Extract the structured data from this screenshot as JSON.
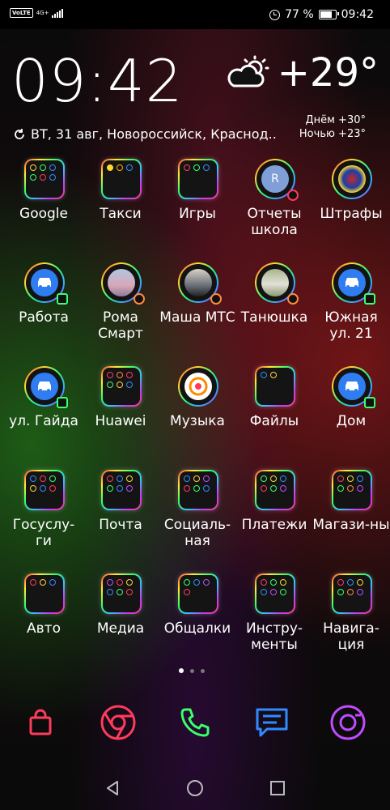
{
  "status": {
    "volte": "VoLTE",
    "network": "4G+",
    "battery": "77 %",
    "battery_level": 0.77,
    "time": "09:42"
  },
  "widget": {
    "time": "09:42",
    "temperature": "+29°",
    "weather_icon": "sun-cloud-icon",
    "day": "Днём +30°",
    "night": "Ночью +23°",
    "date_location": "ВТ, 31 авг, Новороссийск, Краснод.."
  },
  "apps": {
    "row1": [
      {
        "label": "Google",
        "kind": "folder"
      },
      {
        "label": "Такси",
        "kind": "folder"
      },
      {
        "label": "Игры",
        "kind": "folder"
      },
      {
        "label": "Отчеты школа",
        "kind": "contact",
        "avatar_letter": "R"
      },
      {
        "label": "Штрафы",
        "kind": "app"
      }
    ],
    "row2": [
      {
        "label": "Работа",
        "kind": "car"
      },
      {
        "label": "Рома Смарт",
        "kind": "contact"
      },
      {
        "label": "Маша МТС",
        "kind": "contact"
      },
      {
        "label": "Танюшка",
        "kind": "contact"
      },
      {
        "label": "Южная ул. 21",
        "kind": "car"
      }
    ],
    "row3": [
      {
        "label": "ул. Гайда",
        "kind": "car"
      },
      {
        "label": "Huawei",
        "kind": "folder"
      },
      {
        "label": "Музыка",
        "kind": "app"
      },
      {
        "label": "Файлы",
        "kind": "folder"
      },
      {
        "label": "Дом",
        "kind": "car"
      }
    ],
    "row4": [
      {
        "label": "Госуслу-ги",
        "kind": "folder"
      },
      {
        "label": "Почта",
        "kind": "folder"
      },
      {
        "label": "Социаль-ная",
        "kind": "folder"
      },
      {
        "label": "Платежи",
        "kind": "folder"
      },
      {
        "label": "Магази-ны",
        "kind": "folder"
      }
    ],
    "row5": [
      {
        "label": "Авто",
        "kind": "folder"
      },
      {
        "label": "Медиа",
        "kind": "folder"
      },
      {
        "label": "Общалки",
        "kind": "folder"
      },
      {
        "label": "Инстру-менты",
        "kind": "folder"
      },
      {
        "label": "Навига-ция",
        "kind": "folder"
      }
    ]
  },
  "dock": [
    "shopping-bag-icon",
    "chrome-icon",
    "phone-icon",
    "messages-icon",
    "camera-icon"
  ],
  "navigation": [
    "back-icon",
    "home-icon",
    "recents-icon"
  ],
  "colors": {
    "neon_red": "#ff3b5c",
    "neon_green": "#39ff6a",
    "neon_blue": "#2f8cff",
    "neon_purple": "#c04bff",
    "neon_yellow": "#ffd633"
  }
}
